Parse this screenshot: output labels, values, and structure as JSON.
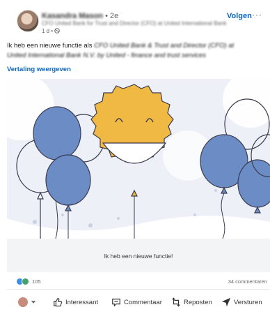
{
  "post": {
    "author_name": "Kasandra Mason",
    "author_degree": "• 2e",
    "author_headline": "CFO United Bank for Trust and Director (CFO) at United International Bank",
    "meta": "1 d •",
    "follow_label": "Volgen",
    "more_label": "···",
    "text_prefix": "Ik heb een nieuwe functie als",
    "text_role": "CFO United Bank & Trust and Director (CFO) at",
    "text_company": "United International Bank N.V. by United - finance and trust services",
    "translate_label": "Vertaling weergeven"
  },
  "image": {
    "caption": "Ik heb een nieuwe functie!",
    "colors": {
      "sky": "#edf0f6",
      "balloon_blue": "#6b8cc4",
      "smiley": "#f0b944",
      "cloud": "#dfe4ee"
    }
  },
  "social": {
    "reaction_count": "105",
    "comments": "34 commentaren"
  },
  "actions": {
    "interessant": "Interessant",
    "commentaar": "Commentaar",
    "reposten": "Reposten",
    "versturen": "Versturen"
  },
  "icons": [
    "avatar",
    "globe-icon",
    "thumbs-up-icon",
    "comment-icon",
    "repost-icon",
    "send-icon",
    "chevron-down-icon"
  ]
}
